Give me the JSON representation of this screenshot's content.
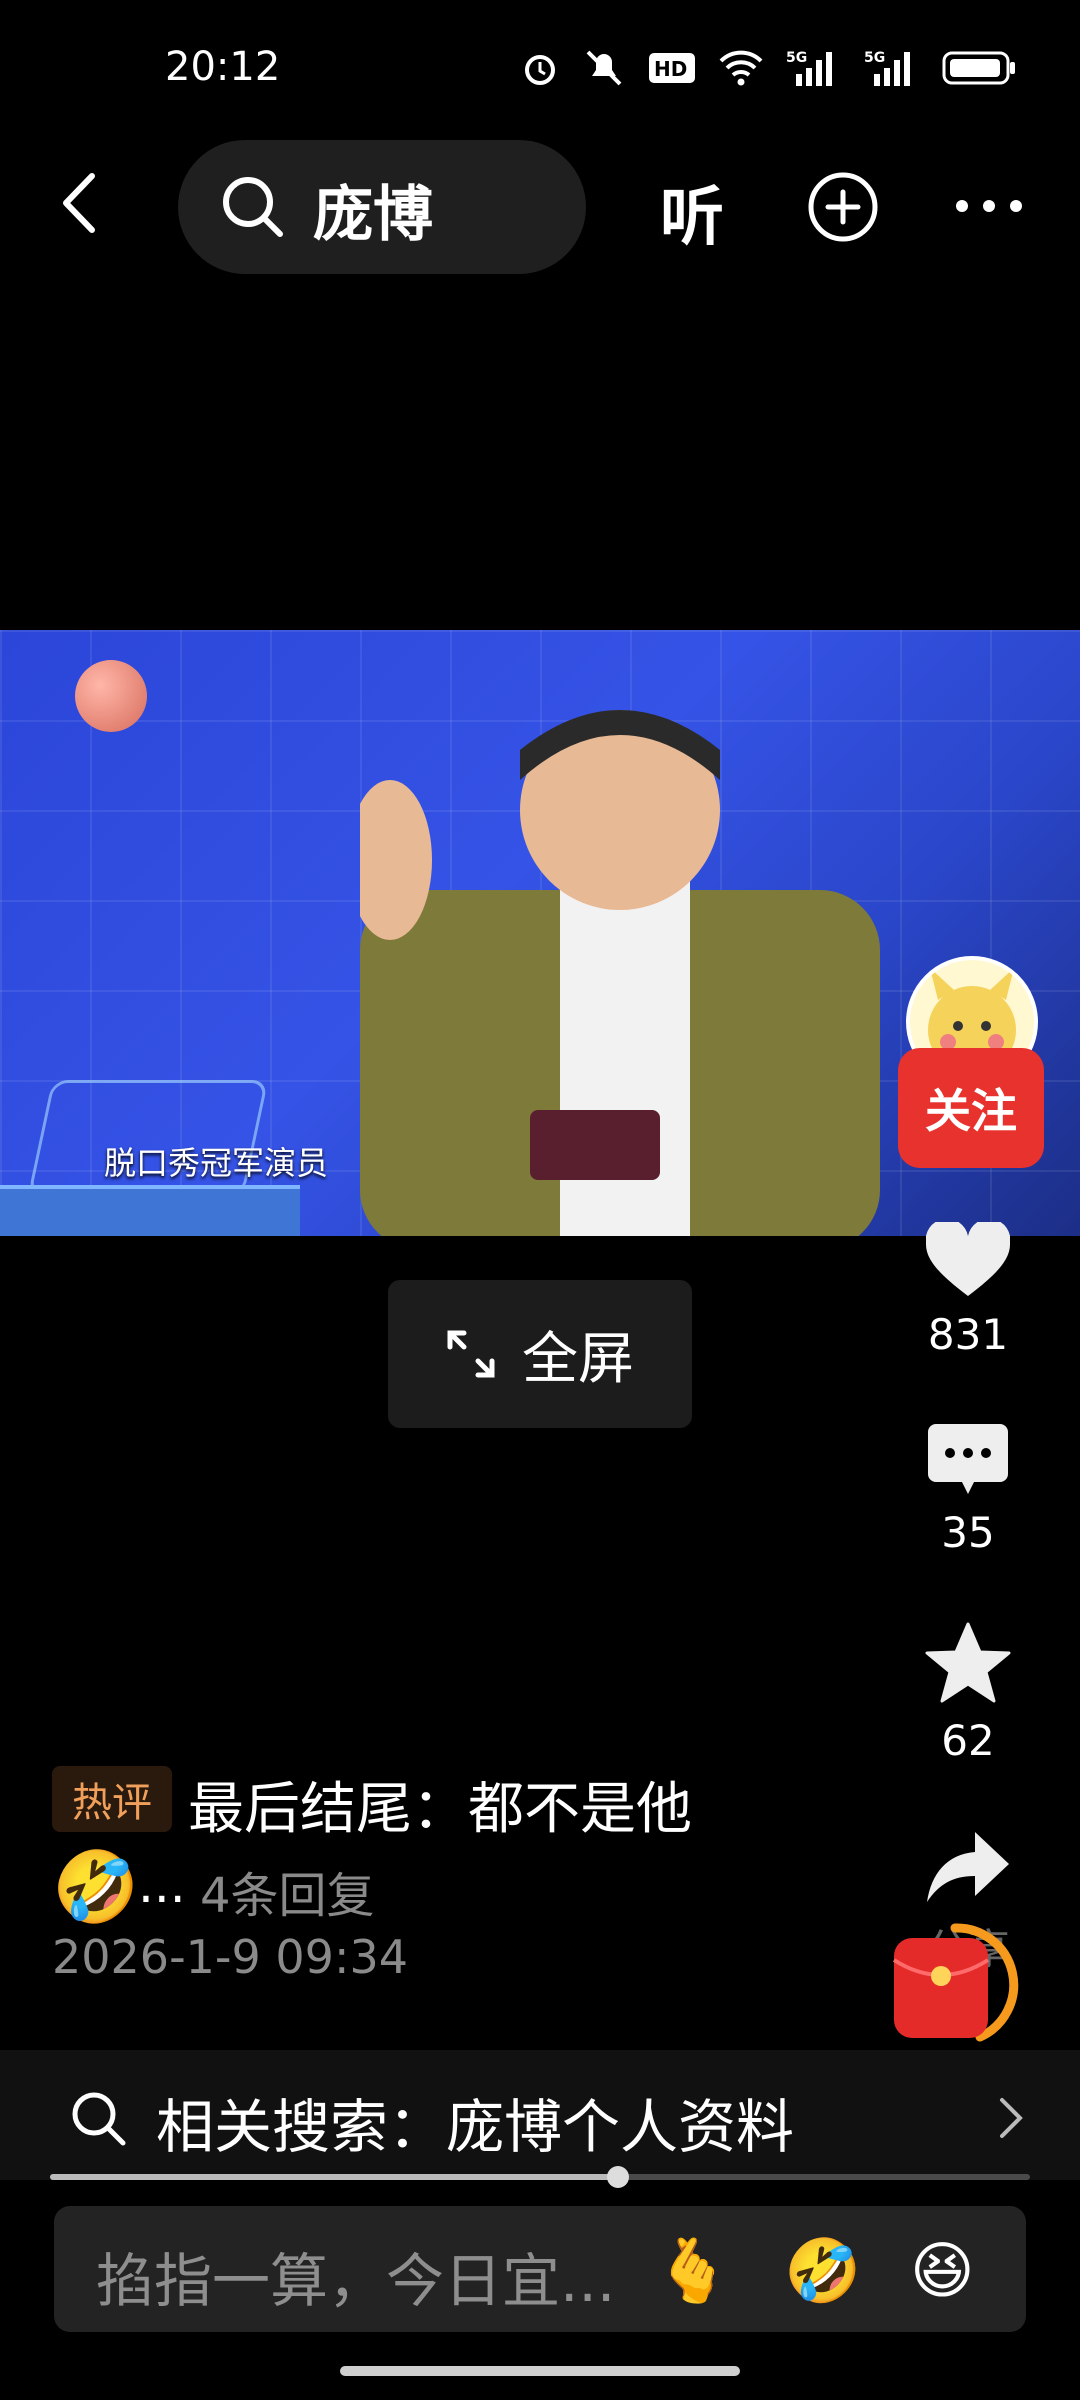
{
  "status_bar": {
    "time": "20:12",
    "icons": [
      "alarm-icon",
      "mute-icon",
      "hd-icon",
      "wifi-icon",
      "signal-5g-icon",
      "signal-5g-icon",
      "battery-icon"
    ],
    "hd_label": "HD",
    "net_label": "5G"
  },
  "top_nav": {
    "search_text": "庞博",
    "listen_label": "听"
  },
  "video": {
    "subtitle": "脱口秀冠军演员"
  },
  "rail": {
    "follow_label": "关注",
    "likes": "831",
    "comments": "35",
    "favorites": "62",
    "share_label": "分享"
  },
  "fullscreen": {
    "label": "全屏"
  },
  "comment": {
    "tag": "热评",
    "text": "最后结尾：都不是他",
    "emoji": "🤣",
    "ellipsis": "...",
    "replies": "4条回复",
    "date": "2026-1-9 09:34"
  },
  "related": {
    "label": "相关搜索：庞博个人资料"
  },
  "progress": {
    "fraction": 0.58
  },
  "input": {
    "placeholder": "掐指一算，今日宜...",
    "emojis": [
      "🫰",
      "🤣",
      "😆"
    ]
  },
  "colors": {
    "accent_red": "#e8322e",
    "hot_tag": "#f0a05a",
    "muted": "#8a8a8a"
  }
}
